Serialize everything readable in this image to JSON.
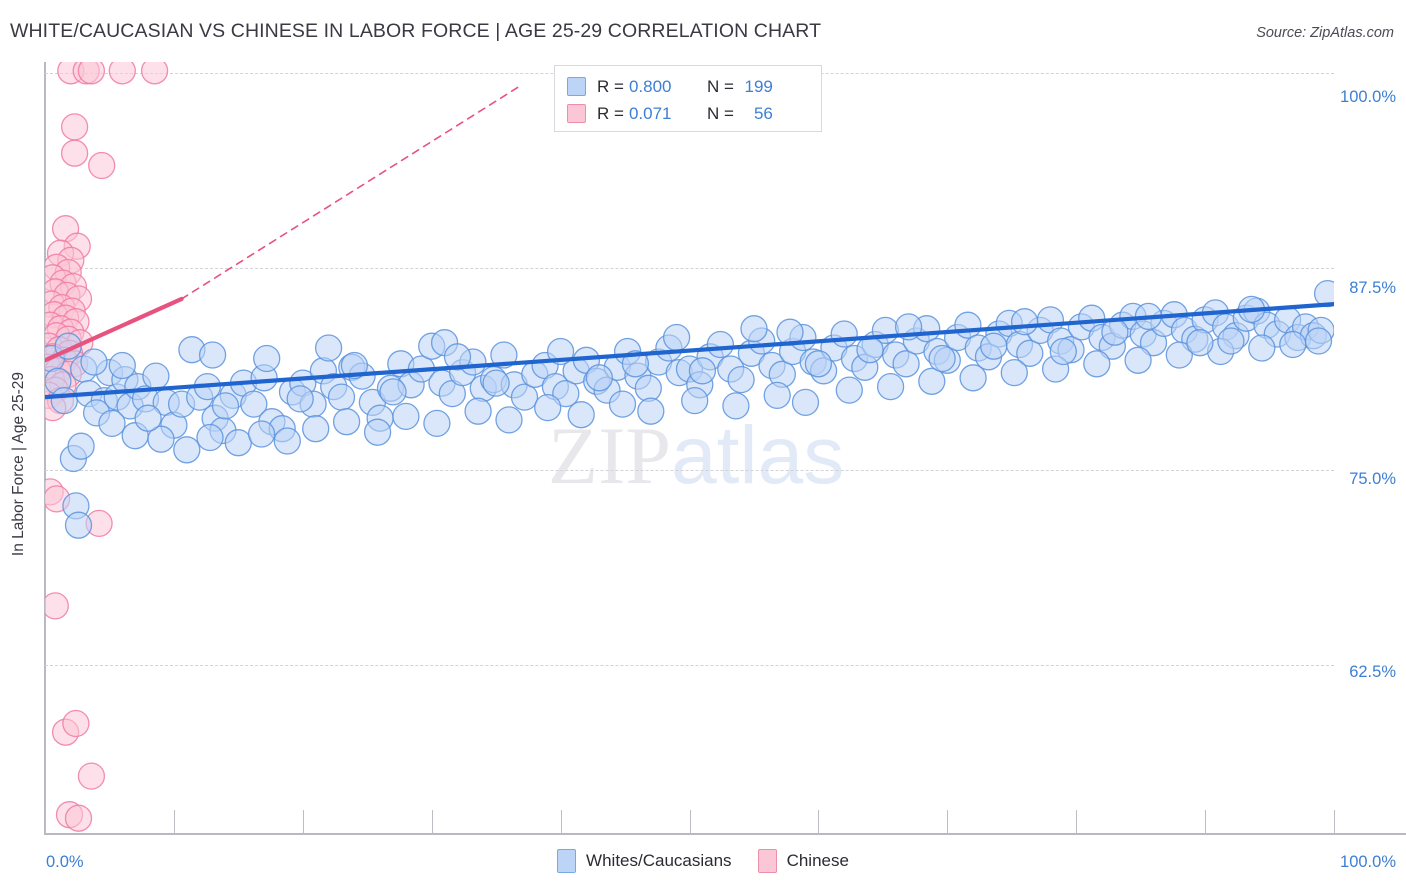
{
  "header": {
    "title": "WHITE/CAUCASIAN VS CHINESE IN LABOR FORCE | AGE 25-29 CORRELATION CHART",
    "source": "Source: ZipAtlas.com"
  },
  "watermark": {
    "part1": "ZIP",
    "part2": "atlas"
  },
  "stats": {
    "blue": {
      "r_label": "R =",
      "r_value": "0.800",
      "n_label": "N =",
      "n_value": "199"
    },
    "pink": {
      "r_label": "R =",
      "r_value": "0.071",
      "n_label": "N =",
      "n_value": "56"
    }
  },
  "legend": {
    "blue_label": "Whites/Caucasians",
    "pink_label": "Chinese"
  },
  "axes": {
    "y_title": "In Labor Force | Age 25-29",
    "y_ticks": [
      "100.0%",
      "87.5%",
      "75.0%",
      "62.5%"
    ],
    "x_min": "0.0%",
    "x_max": "100.0%"
  },
  "colors": {
    "blue_fill": "#bcd4f5",
    "blue_stroke": "#5a93de",
    "blue_line": "#1f64cf",
    "pink_fill": "#fbc7d7",
    "pink_stroke": "#ef7ba3",
    "pink_line": "#e8527f",
    "axis_text": "#3d7fd4",
    "grid": "#d2d2d8"
  },
  "chart_data": {
    "type": "scatter",
    "title": "WHITE/CAUCASIAN VS CHINESE IN LABOR FORCE | AGE 25-29 CORRELATION CHART",
    "xlabel": "",
    "ylabel": "In Labor Force | Age 25-29",
    "xlim": [
      0,
      100
    ],
    "ylim": [
      57.5,
      101.5
    ],
    "x_ticks": [
      0,
      100
    ],
    "y_ticks": [
      62.5,
      75.0,
      87.5,
      100.0
    ],
    "grid": true,
    "legend_position": "bottom-center",
    "series": [
      {
        "name": "Whites/Caucasians",
        "r": 0.8,
        "n": 199,
        "color": "#bcd4f5",
        "trendline": {
          "x0": 0.0,
          "y0": 82.4,
          "x1": 100.0,
          "y1": 87.7,
          "style": "solid"
        },
        "points": [
          [
            0.5,
            84.6
          ],
          [
            1.0,
            83.3
          ],
          [
            1.5,
            82.2
          ],
          [
            2.2,
            78.9
          ],
          [
            2.4,
            76.2
          ],
          [
            2.6,
            75.1
          ],
          [
            3.0,
            84.0
          ],
          [
            3.4,
            82.6
          ],
          [
            4.6,
            82.2
          ],
          [
            5.0,
            83.8
          ],
          [
            5.6,
            82.4
          ],
          [
            6.2,
            83.4
          ],
          [
            6.6,
            81.9
          ],
          [
            7.2,
            83.0
          ],
          [
            7.8,
            82.3
          ],
          [
            8.6,
            83.6
          ],
          [
            9.4,
            82.1
          ],
          [
            10.0,
            80.8
          ],
          [
            10.6,
            82.0
          ],
          [
            11.4,
            85.1
          ],
          [
            12.0,
            82.4
          ],
          [
            12.6,
            83.0
          ],
          [
            13.2,
            81.2
          ],
          [
            13.8,
            80.5
          ],
          [
            14.6,
            82.5
          ],
          [
            15.4,
            83.2
          ],
          [
            16.2,
            82.0
          ],
          [
            17.0,
            83.5
          ],
          [
            17.6,
            81.0
          ],
          [
            18.4,
            80.6
          ],
          [
            19.2,
            82.7
          ],
          [
            20.0,
            83.2
          ],
          [
            20.8,
            82.0
          ],
          [
            21.6,
            83.9
          ],
          [
            22.4,
            83.0
          ],
          [
            23.0,
            82.4
          ],
          [
            23.8,
            84.1
          ],
          [
            24.6,
            83.6
          ],
          [
            25.4,
            82.1
          ],
          [
            26.0,
            81.2
          ],
          [
            26.8,
            82.9
          ],
          [
            27.6,
            84.3
          ],
          [
            28.4,
            83.1
          ],
          [
            29.2,
            84.0
          ],
          [
            30.0,
            85.3
          ],
          [
            30.8,
            83.2
          ],
          [
            31.6,
            82.6
          ],
          [
            32.4,
            83.8
          ],
          [
            33.2,
            84.4
          ],
          [
            34.0,
            82.9
          ],
          [
            34.8,
            83.4
          ],
          [
            35.6,
            84.8
          ],
          [
            36.4,
            83.1
          ],
          [
            37.2,
            82.4
          ],
          [
            38.0,
            83.7
          ],
          [
            38.8,
            84.2
          ],
          [
            39.6,
            83.0
          ],
          [
            40.4,
            82.6
          ],
          [
            41.2,
            83.9
          ],
          [
            42.0,
            84.5
          ],
          [
            42.8,
            83.3
          ],
          [
            43.6,
            82.8
          ],
          [
            44.4,
            84.1
          ],
          [
            45.2,
            85.0
          ],
          [
            46.0,
            83.6
          ],
          [
            46.8,
            82.9
          ],
          [
            47.6,
            84.4
          ],
          [
            48.4,
            85.2
          ],
          [
            49.2,
            83.8
          ],
          [
            50.0,
            84.0
          ],
          [
            50.8,
            83.1
          ],
          [
            51.6,
            84.7
          ],
          [
            52.4,
            85.4
          ],
          [
            53.2,
            84.0
          ],
          [
            54.0,
            83.4
          ],
          [
            54.8,
            84.9
          ],
          [
            55.6,
            85.6
          ],
          [
            56.4,
            84.2
          ],
          [
            57.2,
            83.7
          ],
          [
            58.0,
            85.0
          ],
          [
            58.8,
            85.8
          ],
          [
            59.6,
            84.4
          ],
          [
            60.4,
            83.9
          ],
          [
            61.2,
            85.2
          ],
          [
            62.0,
            86.0
          ],
          [
            62.8,
            84.6
          ],
          [
            63.6,
            84.1
          ],
          [
            64.4,
            85.4
          ],
          [
            65.2,
            86.2
          ],
          [
            66.0,
            84.8
          ],
          [
            66.8,
            84.3
          ],
          [
            67.6,
            85.6
          ],
          [
            68.4,
            86.3
          ],
          [
            69.2,
            85.0
          ],
          [
            70.0,
            84.5
          ],
          [
            70.8,
            85.8
          ],
          [
            71.6,
            86.5
          ],
          [
            72.4,
            85.2
          ],
          [
            73.2,
            84.7
          ],
          [
            74.0,
            86.0
          ],
          [
            74.8,
            86.6
          ],
          [
            75.6,
            85.4
          ],
          [
            76.4,
            84.9
          ],
          [
            77.2,
            86.2
          ],
          [
            78.0,
            86.8
          ],
          [
            78.8,
            85.6
          ],
          [
            79.6,
            85.1
          ],
          [
            80.4,
            86.4
          ],
          [
            81.2,
            86.9
          ],
          [
            82.0,
            85.8
          ],
          [
            82.8,
            85.3
          ],
          [
            83.6,
            86.5
          ],
          [
            84.4,
            87.0
          ],
          [
            85.2,
            86.0
          ],
          [
            86.0,
            85.5
          ],
          [
            86.8,
            86.6
          ],
          [
            87.6,
            87.1
          ],
          [
            88.4,
            86.2
          ],
          [
            89.2,
            85.7
          ],
          [
            90.0,
            86.8
          ],
          [
            90.8,
            87.2
          ],
          [
            91.6,
            86.4
          ],
          [
            92.4,
            85.9
          ],
          [
            93.2,
            86.9
          ],
          [
            94.0,
            87.3
          ],
          [
            94.8,
            86.5
          ],
          [
            95.6,
            86.0
          ],
          [
            96.4,
            86.8
          ],
          [
            97.2,
            85.8
          ],
          [
            97.8,
            86.4
          ],
          [
            98.4,
            85.9
          ],
          [
            99.5,
            88.3
          ],
          [
            4.0,
            81.5
          ],
          [
            5.2,
            80.9
          ],
          [
            7.0,
            80.2
          ],
          [
            9.0,
            80.0
          ],
          [
            11.0,
            79.4
          ],
          [
            12.8,
            80.1
          ],
          [
            15.0,
            79.8
          ],
          [
            16.8,
            80.3
          ],
          [
            18.8,
            79.9
          ],
          [
            21.0,
            80.6
          ],
          [
            23.4,
            81.0
          ],
          [
            25.8,
            80.4
          ],
          [
            28.0,
            81.3
          ],
          [
            30.4,
            80.9
          ],
          [
            33.6,
            81.6
          ],
          [
            36.0,
            81.1
          ],
          [
            39.0,
            81.8
          ],
          [
            41.6,
            81.4
          ],
          [
            44.8,
            82.0
          ],
          [
            47.0,
            81.6
          ],
          [
            50.4,
            82.2
          ],
          [
            53.6,
            81.9
          ],
          [
            56.8,
            82.5
          ],
          [
            59.0,
            82.1
          ],
          [
            62.4,
            82.8
          ],
          [
            65.6,
            83.0
          ],
          [
            68.8,
            83.3
          ],
          [
            72.0,
            83.5
          ],
          [
            75.2,
            83.8
          ],
          [
            78.4,
            84.0
          ],
          [
            81.6,
            84.3
          ],
          [
            84.8,
            84.5
          ],
          [
            88.0,
            84.8
          ],
          [
            91.2,
            85.0
          ],
          [
            94.4,
            85.2
          ],
          [
            96.8,
            85.4
          ],
          [
            2.8,
            79.6
          ],
          [
            8.0,
            81.2
          ],
          [
            14.0,
            81.9
          ],
          [
            19.8,
            82.3
          ],
          [
            27.0,
            82.7
          ],
          [
            35.0,
            83.2
          ],
          [
            43.0,
            83.5
          ],
          [
            51.0,
            83.9
          ],
          [
            60.0,
            84.3
          ],
          [
            69.6,
            84.6
          ],
          [
            79.0,
            85.0
          ],
          [
            89.6,
            85.5
          ],
          [
            6.0,
            84.2
          ],
          [
            13.0,
            84.8
          ],
          [
            22.0,
            85.2
          ],
          [
            31.0,
            85.5
          ],
          [
            40.0,
            85.0
          ],
          [
            49.0,
            85.8
          ],
          [
            57.8,
            86.1
          ],
          [
            67.0,
            86.4
          ],
          [
            76.0,
            86.7
          ],
          [
            85.6,
            87.0
          ],
          [
            93.6,
            87.4
          ],
          [
            99.0,
            86.2
          ],
          [
            1.8,
            85.3
          ],
          [
            3.8,
            84.4
          ],
          [
            17.2,
            84.6
          ],
          [
            24.0,
            84.2
          ],
          [
            32.0,
            84.7
          ],
          [
            45.8,
            84.3
          ],
          [
            55.0,
            86.3
          ],
          [
            64.0,
            85.1
          ],
          [
            73.6,
            85.3
          ],
          [
            83.0,
            86.1
          ],
          [
            92.0,
            85.6
          ],
          [
            98.8,
            85.6
          ]
        ]
      },
      {
        "name": "Chinese",
        "r": 0.071,
        "n": 56,
        "color": "#fbc7d7",
        "trendline": {
          "x0": 0.0,
          "y0": 84.5,
          "x1": 10.6,
          "y1": 88.0,
          "style": "solid"
        },
        "trendline_extension": {
          "x0": 10.6,
          "y0": 88.0,
          "x1": 37.0,
          "y1": 100.2,
          "style": "dashed"
        },
        "points": [
          [
            2.0,
            101.0
          ],
          [
            3.2,
            101.0
          ],
          [
            3.6,
            101.0
          ],
          [
            6.0,
            101.0
          ],
          [
            8.5,
            101.0
          ],
          [
            2.3,
            97.8
          ],
          [
            2.3,
            96.3
          ],
          [
            4.4,
            95.6
          ],
          [
            1.6,
            92.0
          ],
          [
            2.5,
            91.0
          ],
          [
            1.2,
            90.6
          ],
          [
            2.0,
            90.2
          ],
          [
            0.9,
            89.8
          ],
          [
            1.8,
            89.5
          ],
          [
            0.6,
            89.2
          ],
          [
            1.4,
            88.9
          ],
          [
            2.2,
            88.7
          ],
          [
            0.8,
            88.4
          ],
          [
            1.7,
            88.2
          ],
          [
            2.6,
            88.0
          ],
          [
            0.5,
            87.7
          ],
          [
            1.3,
            87.5
          ],
          [
            2.1,
            87.3
          ],
          [
            0.7,
            87.1
          ],
          [
            1.6,
            86.9
          ],
          [
            2.4,
            86.7
          ],
          [
            0.4,
            86.5
          ],
          [
            1.2,
            86.3
          ],
          [
            2.0,
            86.1
          ],
          [
            0.9,
            85.9
          ],
          [
            1.8,
            85.7
          ],
          [
            2.7,
            85.5
          ],
          [
            0.3,
            85.3
          ],
          [
            1.1,
            85.1
          ],
          [
            1.9,
            84.9
          ],
          [
            0.6,
            84.7
          ],
          [
            1.5,
            84.5
          ],
          [
            2.3,
            84.3
          ],
          [
            0.2,
            84.1
          ],
          [
            1.0,
            83.9
          ],
          [
            1.8,
            83.7
          ],
          [
            0.5,
            83.4
          ],
          [
            1.4,
            83.1
          ],
          [
            0.8,
            82.8
          ],
          [
            0.3,
            82.5
          ],
          [
            1.2,
            82.2
          ],
          [
            0.6,
            81.8
          ],
          [
            0.4,
            77.0
          ],
          [
            0.9,
            76.6
          ],
          [
            4.2,
            75.2
          ],
          [
            0.8,
            70.5
          ],
          [
            1.6,
            63.3
          ],
          [
            2.4,
            63.8
          ],
          [
            3.6,
            60.8
          ],
          [
            1.9,
            58.6
          ],
          [
            2.6,
            58.4
          ]
        ]
      }
    ]
  }
}
